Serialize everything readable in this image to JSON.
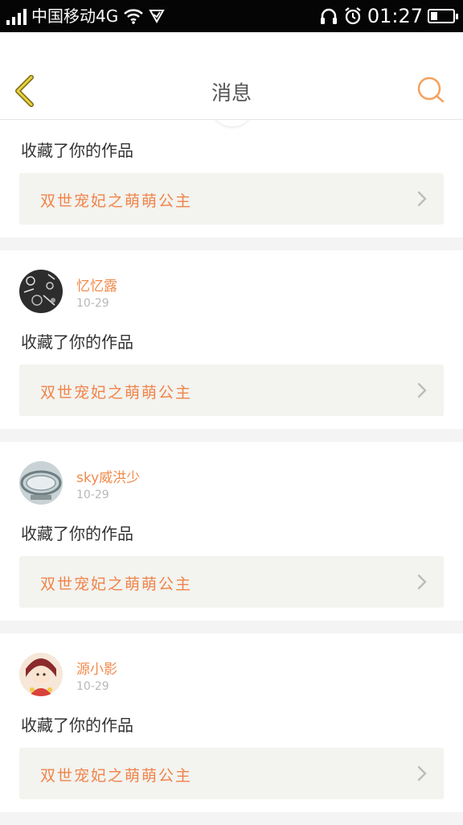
{
  "status_bar": {
    "carrier": "中国移动4G",
    "time": "01:27",
    "icons": [
      "signal-icon",
      "wifi-icon",
      "vpn-shield-icon",
      "headphones-icon",
      "alarm-icon",
      "battery-icon"
    ]
  },
  "header": {
    "title": "消息",
    "back_icon": "chevron-left-icon",
    "search_icon": "search-icon"
  },
  "colors": {
    "accent": "#f08a4b",
    "work_bg": "#f3f3ef",
    "page_bg": "#f4f4f4"
  },
  "first_card": {
    "action": "收藏了你的作品",
    "work_title": "双世宠妃之萌萌公主"
  },
  "messages": [
    {
      "username": "忆忆露",
      "date": "10-29",
      "action": "收藏了你的作品",
      "work_title": "双世宠妃之萌萌公主"
    },
    {
      "username": "sky威洪少",
      "date": "10-29",
      "action": "收藏了你的作品",
      "work_title": "双世宠妃之萌萌公主"
    },
    {
      "username": "源小影",
      "date": "10-29",
      "action": "收藏了你的作品",
      "work_title": "双世宠妃之萌萌公主"
    }
  ]
}
